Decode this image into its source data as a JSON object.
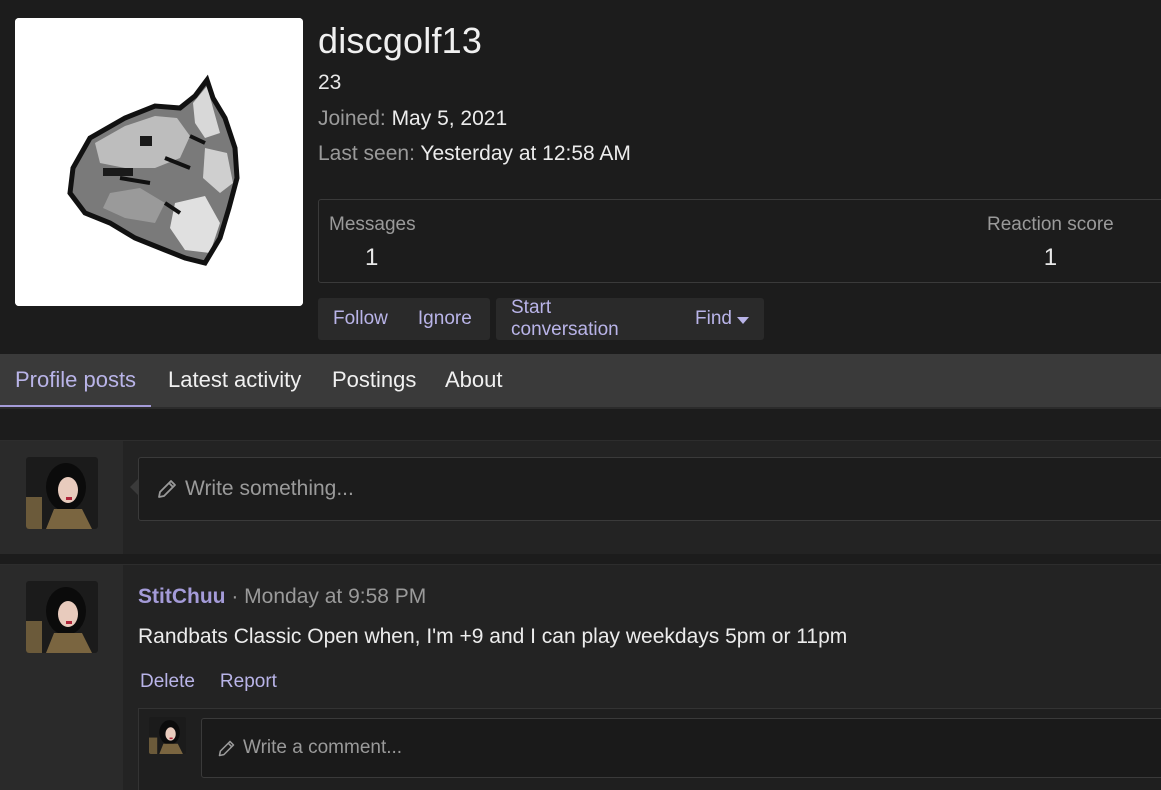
{
  "profile": {
    "username": "discgolf13",
    "title": "23",
    "joined_label": "Joined:",
    "joined_value": "May 5, 2021",
    "last_seen_label": "Last seen:",
    "last_seen_value": "Yesterday at 12:58 AM",
    "avatar_icon": "pixel-pokemon-avatar"
  },
  "stats": {
    "messages_label": "Messages",
    "messages_value": "1",
    "reaction_label": "Reaction score",
    "reaction_value": "1"
  },
  "actions": {
    "follow": "Follow",
    "ignore": "Ignore",
    "start_conversation": "Start conversation",
    "find": "Find"
  },
  "tabs": [
    {
      "label": "Profile posts",
      "active": true
    },
    {
      "label": "Latest activity",
      "active": false
    },
    {
      "label": "Postings",
      "active": false
    },
    {
      "label": "About",
      "active": false
    }
  ],
  "composer": {
    "placeholder": "Write something..."
  },
  "post": {
    "author": "StitChuu",
    "separator": "·",
    "time": "Monday at 9:58 PM",
    "text": "Randbats Classic Open when, I'm +9 and I can play weekdays 5pm or 11pm",
    "delete_label": "Delete",
    "report_label": "Report",
    "comment_placeholder": "Write a comment..."
  },
  "colors": {
    "accent": "#a49bd8",
    "link": "#b9b4e8",
    "background": "#1c1c1c"
  }
}
